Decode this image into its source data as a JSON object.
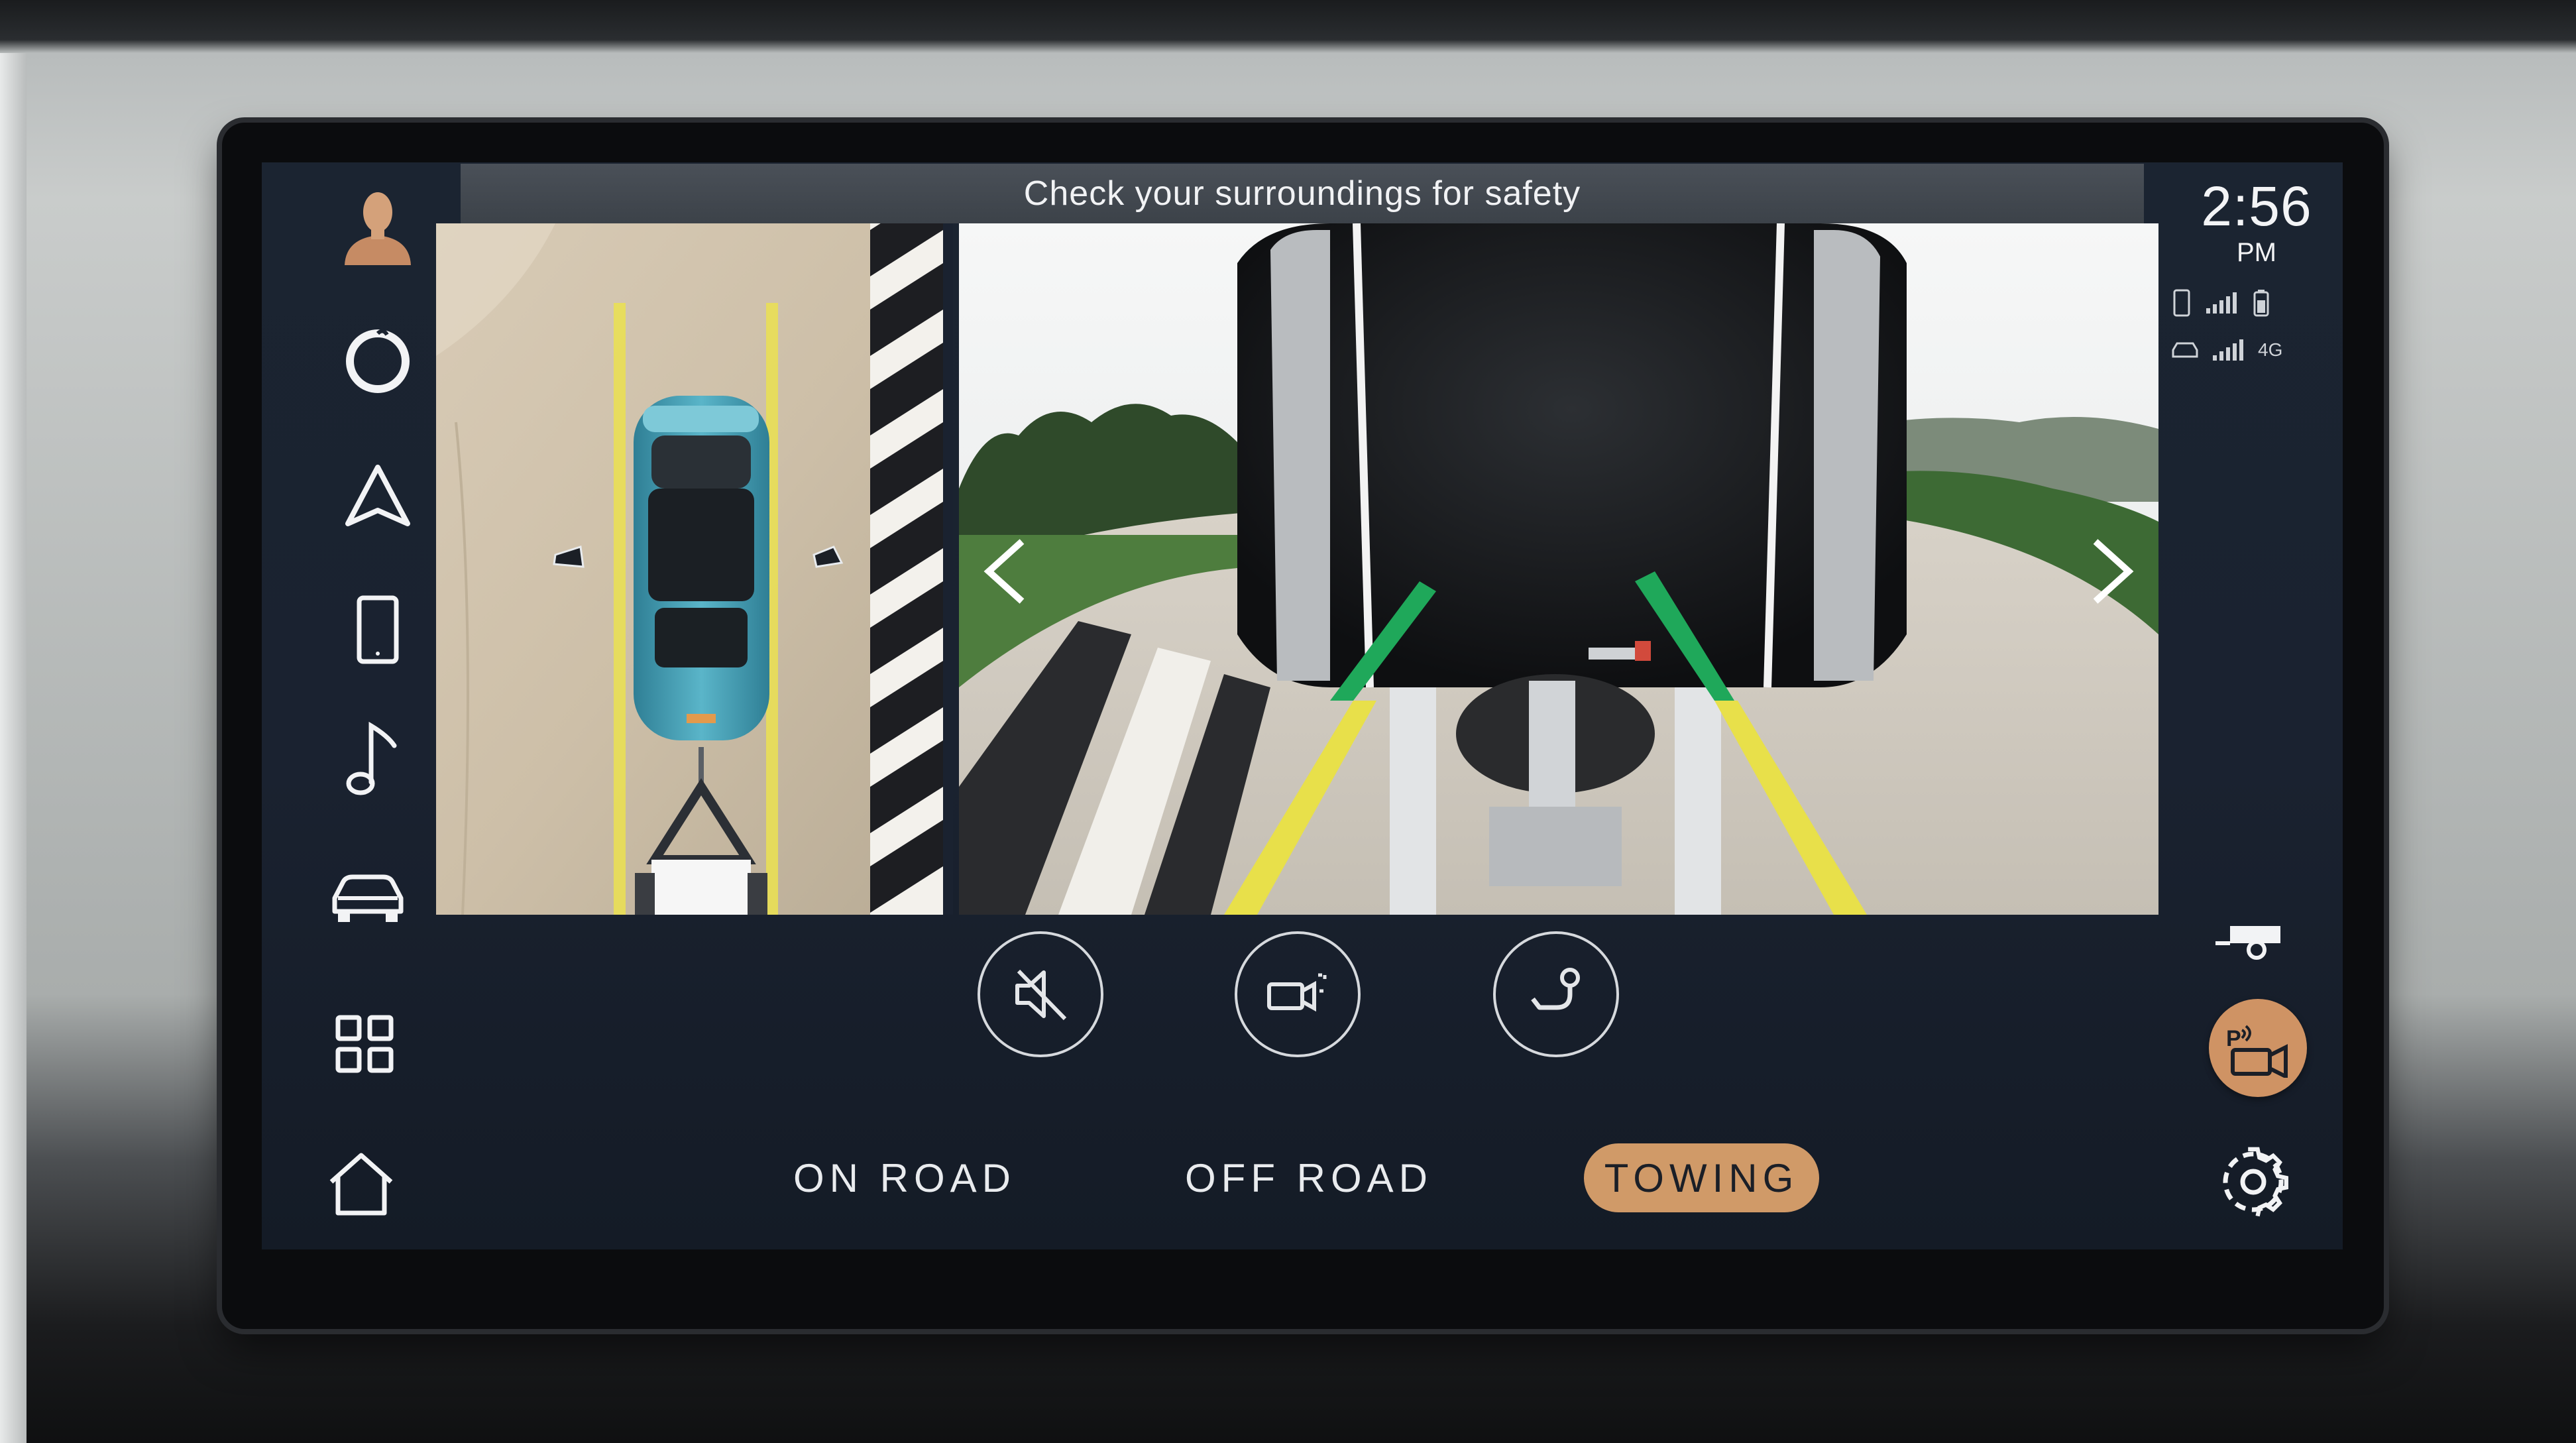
{
  "banner": {
    "text": "Check your surroundings for safety"
  },
  "clock": {
    "time": "2:56",
    "ampm": "PM"
  },
  "status": {
    "phone_network": "4G"
  },
  "sidebar": {
    "items": [
      {
        "name": "profile",
        "icon": "user-avatar-icon"
      },
      {
        "name": "voice-assistant",
        "icon": "ring-icon"
      },
      {
        "name": "navigation",
        "icon": "navigation-arrow-icon"
      },
      {
        "name": "phone",
        "icon": "phone-icon"
      },
      {
        "name": "media",
        "icon": "music-note-icon"
      },
      {
        "name": "vehicle",
        "icon": "car-icon"
      },
      {
        "name": "apps",
        "icon": "grid-icon"
      },
      {
        "name": "home",
        "icon": "home-icon"
      }
    ]
  },
  "controls": {
    "buttons": [
      {
        "name": "mute",
        "icon": "speaker-muted-icon"
      },
      {
        "name": "camera-guides",
        "icon": "camera-guides-icon"
      },
      {
        "name": "tow-hitch",
        "icon": "tow-hitch-icon"
      }
    ]
  },
  "modes": {
    "items": [
      {
        "label": "ON ROAD",
        "active": false
      },
      {
        "label": "OFF ROAD",
        "active": false
      },
      {
        "label": "TOWING",
        "active": true
      }
    ]
  },
  "right_rail": {
    "trailer_icon": "trailer-icon",
    "parking_camera_icon": "parking-camera-icon",
    "parking_camera_label": "P",
    "settings_icon": "gear-icon"
  },
  "colors": {
    "accent": "#d09a68",
    "guide_green": "#1fa85a",
    "guide_yellow": "#e8e04a"
  }
}
